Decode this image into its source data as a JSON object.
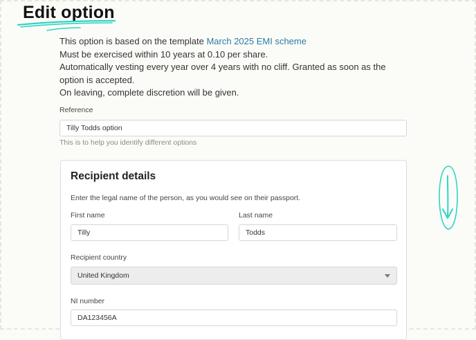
{
  "page": {
    "title": "Edit option"
  },
  "info": {
    "template_prefix": "This option is based on the template ",
    "template_link": "March 2025 EMI scheme",
    "line2": "Must be exercised within 10 years at 0.10 per share.",
    "line3": "Automatically vesting every year over 4 years with no cliff. Granted as soon as the option is accepted.",
    "line4": "On leaving, complete discretion will be given."
  },
  "reference": {
    "label": "Reference",
    "value": "Tilly Todds option",
    "hint": "This is to help you identify different options"
  },
  "recipient": {
    "title": "Recipient details",
    "description": "Enter the legal name of the person, as you would see on their passport.",
    "first_name_label": "First name",
    "first_name_value": "Tilly",
    "last_name_label": "Last name",
    "last_name_value": "Todds",
    "country_label": "Recipient country",
    "country_value": "United Kingdom",
    "ni_label": "NI number",
    "ni_value": "DA123456A"
  },
  "colors": {
    "accent_scribble": "#2fd4c6",
    "link": "#2d7ba6"
  },
  "icons": [
    "title-underline-scribble",
    "scroll-down-arrow-icon",
    "chevron-down-icon"
  ]
}
